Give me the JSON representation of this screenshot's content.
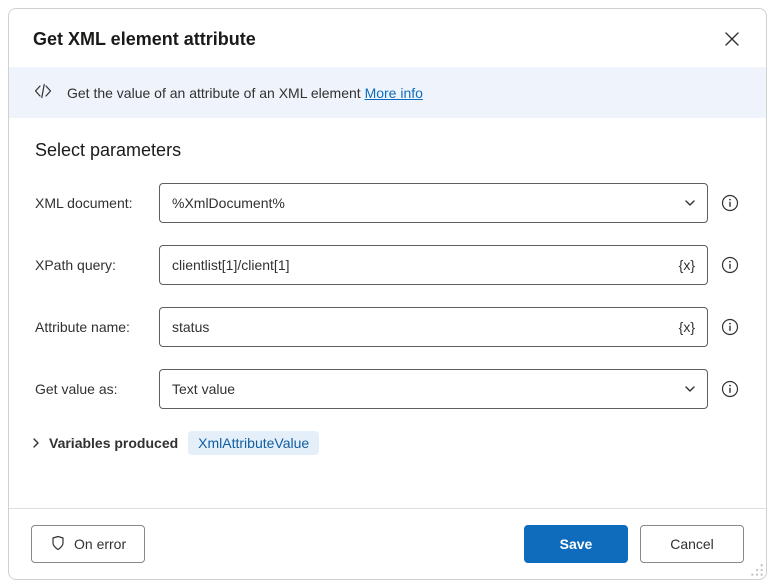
{
  "header": {
    "title": "Get XML element attribute"
  },
  "banner": {
    "description": "Get the value of an attribute of an XML element",
    "more_info": "More info"
  },
  "section": {
    "title": "Select parameters"
  },
  "params": {
    "xml_document": {
      "label": "XML document:",
      "value": "%XmlDocument%"
    },
    "xpath_query": {
      "label": "XPath query:",
      "value": "clientlist[1]/client[1]"
    },
    "attribute_name": {
      "label": "Attribute name:",
      "value": "status"
    },
    "get_value_as": {
      "label": "Get value as:",
      "value": "Text value"
    }
  },
  "variables": {
    "label": "Variables produced",
    "badge": "XmlAttributeValue"
  },
  "footer": {
    "on_error": "On error",
    "save": "Save",
    "cancel": "Cancel"
  },
  "icons": {
    "var_token": "{x}"
  }
}
